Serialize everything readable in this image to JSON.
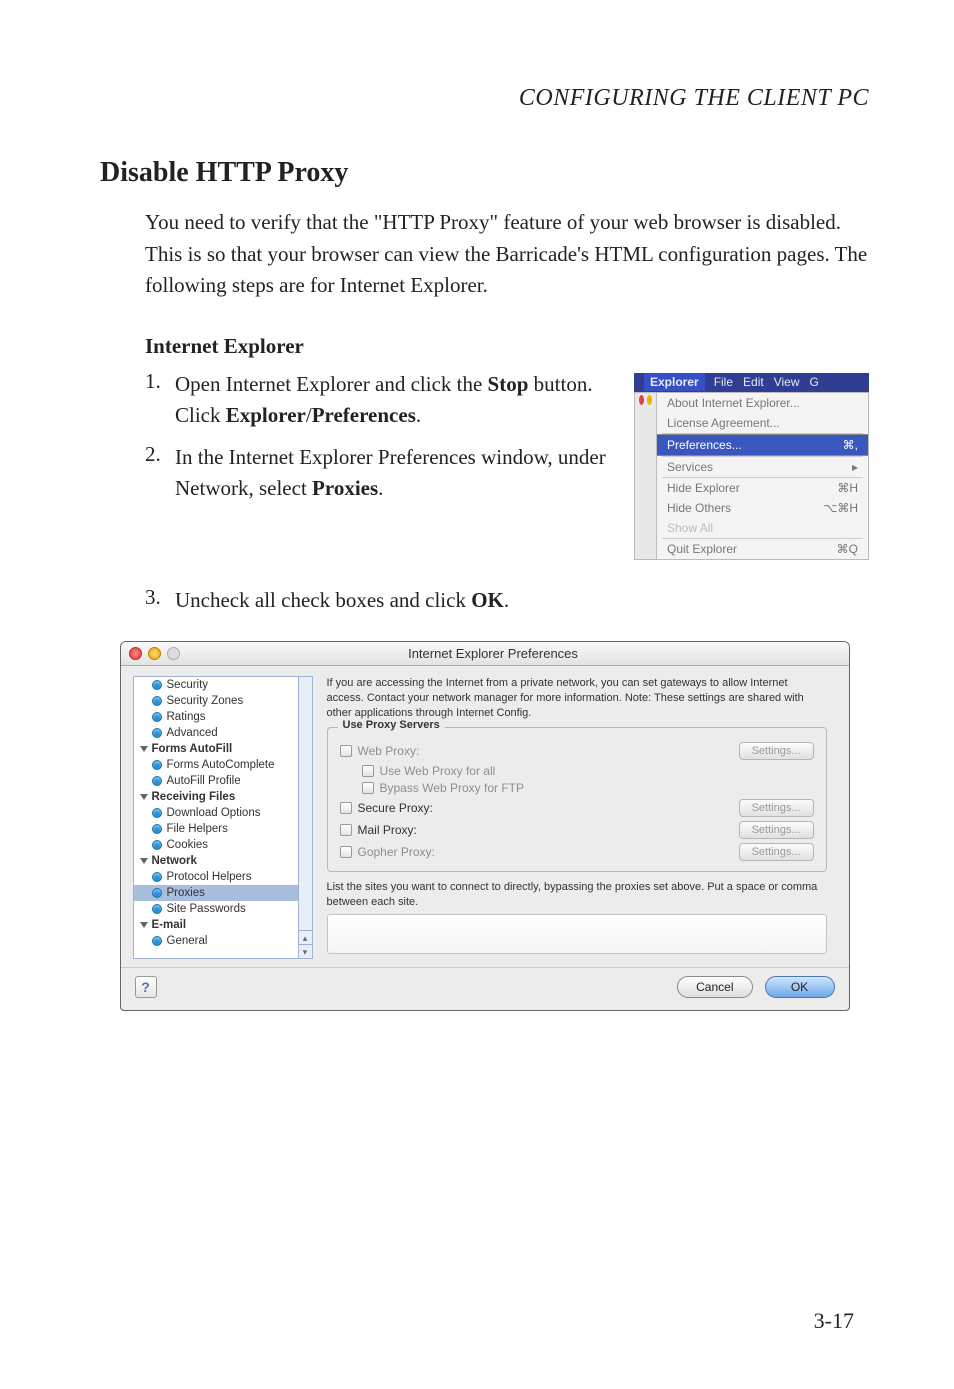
{
  "page": {
    "header": "CONFIGURING THE CLIENT PC",
    "page_number": "3-17"
  },
  "content": {
    "h2": "Disable HTTP Proxy",
    "intro": "You need to verify that the \"HTTP Proxy\" feature of your web browser is disabled. This is so that your browser can view the Barricade's HTML configuration pages. The following steps are for Internet Explorer.",
    "h3": "Internet Explorer",
    "step1_num": "1.",
    "step1_a": "Open Internet Explorer and click the ",
    "step1_b": "Stop",
    "step1_c": " button. Click ",
    "step1_d": "Explorer",
    "step1_e": "/",
    "step1_f": "Preferences",
    "step1_g": ".",
    "step2_num": "2.",
    "step2_a": "In the Internet Explorer Preferences window, under Network, select ",
    "step2_b": "Proxies",
    "step2_c": ".",
    "step3_num": "3.",
    "step3_a": "Uncheck all check boxes and click ",
    "step3_b": "OK",
    "step3_c": "."
  },
  "menu": {
    "bar": {
      "sel": "Explorer",
      "i1": "File",
      "i2": "Edit",
      "i3": "View",
      "i4": "G"
    },
    "items": {
      "about": "About Internet Explorer...",
      "license": "License Agreement...",
      "prefs": "Preferences...",
      "services": "Services",
      "hide_exp": "Hide Explorer",
      "hide_exp_sc": "⌘H",
      "hide_oth": "Hide Others",
      "hide_oth_sc": "⌥⌘H",
      "show_all": "Show All",
      "quit": "Quit Explorer",
      "quit_sc": "⌘Q",
      "prefs_sc": "⌘,"
    }
  },
  "prefs": {
    "title": "Internet Explorer Preferences",
    "desc": "If you are accessing the Internet from a private network, you can set gateways to allow Internet access.  Contact your network manager for more information.  Note: These settings are shared with other applications through Internet Config.",
    "group_title": "Use Proxy Servers",
    "web_proxy": "Web Proxy:",
    "use_web": "Use Web Proxy for all",
    "bypass_ftp": "Bypass Web Proxy for FTP",
    "secure": "Secure Proxy:",
    "mail": "Mail Proxy:",
    "gopher": "Gopher Proxy:",
    "settings": "Settings...",
    "note": "List the sites you want to connect to directly,  bypassing the proxies set above.  Put a space or comma between each site.",
    "cancel": "Cancel",
    "ok": "OK",
    "help": "?",
    "sidebar": {
      "security": "Security",
      "zones": "Security Zones",
      "ratings": "Ratings",
      "advanced": "Advanced",
      "forms_autofill": "Forms AutoFill",
      "forms_ac": "Forms AutoComplete",
      "autofill_profile": "AutoFill Profile",
      "receiving": "Receiving Files",
      "download": "Download Options",
      "file_helpers": "File Helpers",
      "cookies": "Cookies",
      "network": "Network",
      "protocol": "Protocol Helpers",
      "proxies": "Proxies",
      "site_pw": "Site Passwords",
      "email": "E-mail",
      "general": "General"
    }
  }
}
